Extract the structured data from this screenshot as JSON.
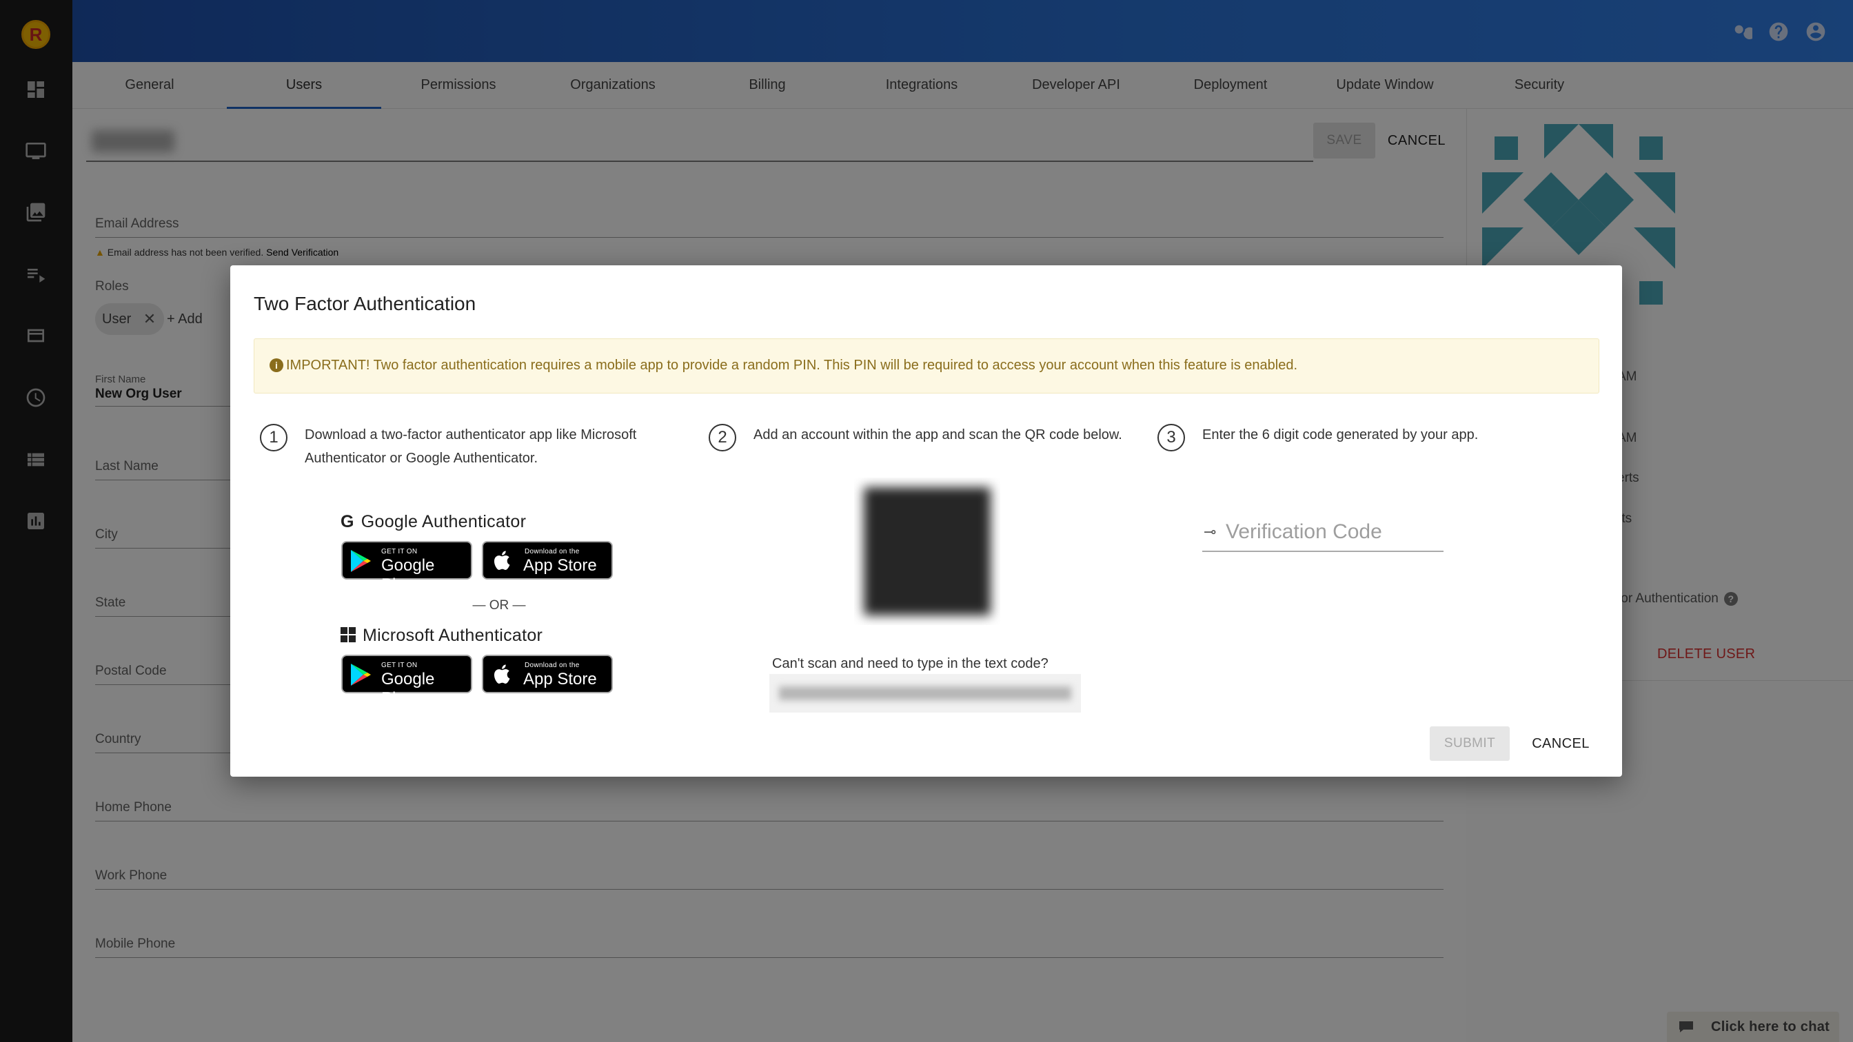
{
  "topbar": {
    "search_icon": "search-icon",
    "help_icon": "help-icon",
    "account_icon": "account-icon"
  },
  "tabs": [
    {
      "label": "General"
    },
    {
      "label": "Users"
    },
    {
      "label": "Permissions"
    },
    {
      "label": "Organizations"
    },
    {
      "label": "Billing"
    },
    {
      "label": "Integrations"
    },
    {
      "label": "Developer API"
    },
    {
      "label": "Deployment"
    },
    {
      "label": "Update Window"
    },
    {
      "label": "Security"
    }
  ],
  "form": {
    "save_label": "SAVE",
    "cancel_label": "CANCEL",
    "email_label": "Email Address",
    "verify_note": "Email address has not been verified.",
    "verify_link": "Send Verification",
    "roles_label": "Roles",
    "role_chip": "User",
    "add_role": "+ Add",
    "first_name_label": "First Name",
    "first_name_value": "New Org User",
    "last_name_label": "Last Name",
    "city_label": "City",
    "state_label": "State",
    "postal_label": "Postal Code",
    "country_label": "Country",
    "home_phone_label": "Home Phone",
    "work_phone_label": "Work Phone",
    "mobile_phone_label": "Mobile Phone"
  },
  "right_panel": {
    "am_1": "AM",
    "am_2": "AM",
    "erts_1": "erts",
    "erts_2": "rts",
    "r": "r",
    "tfa": "tor Authentication",
    "delete_user": "DELETE USER"
  },
  "dialog": {
    "title": "Two Factor Authentication",
    "alert": "IMPORTANT! Two factor authentication requires a mobile app to provide a random PIN. This PIN will be required to access your account when this feature is enabled.",
    "step1_num": "1",
    "step1_line1": "Download a two-factor authenticator app like Microsoft",
    "step1_line2": "Authenticator or Google Authenticator.",
    "step2_num": "2",
    "step2_text": "Add an account within the app and scan the QR code below.",
    "step3_num": "3",
    "step3_text": "Enter the 6 digit code generated by your app.",
    "google_title": "Google Authenticator",
    "microsoft_title": "Microsoft Authenticator",
    "or_label": "— OR —",
    "gp_small": "GET IT ON",
    "gp_big": "Google Play",
    "as_small": "Download on the",
    "as_big": "App Store",
    "cant_scan": "Can't scan and need to type in the text code?",
    "verification_placeholder": "Verification Code",
    "submit_label": "SUBMIT",
    "cancel_label": "CANCEL"
  },
  "chat": {
    "label": "Click here to chat"
  }
}
